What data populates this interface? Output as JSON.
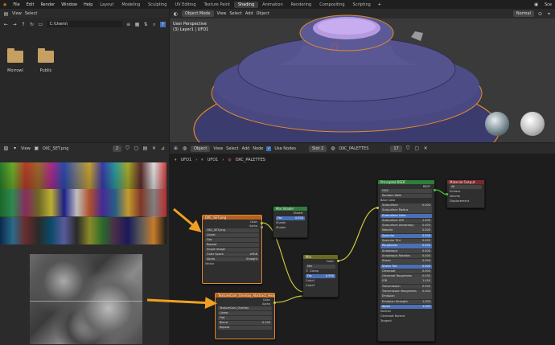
{
  "menu": {
    "items": [
      "File",
      "Edit",
      "Render",
      "Window",
      "Help"
    ],
    "workspaces": [
      "Layout",
      "Modeling",
      "Sculpting",
      "UV Editing",
      "Texture Paint",
      "Shading",
      "Animation",
      "Rendering",
      "Compositing",
      "Scripting"
    ],
    "active_workspace": "Shading",
    "scene_label": "Sce"
  },
  "file_browser": {
    "view": "View",
    "select": "Select",
    "path": "C:\\Users\\",
    "folders": [
      "Morrowl",
      "Public"
    ]
  },
  "viewport": {
    "mode": "Object Mode",
    "menu": [
      "View",
      "Select",
      "Add",
      "Object"
    ],
    "shading": "Normal",
    "info_line1": "User Perspective",
    "info_line2": "(3) Layer1 | UFO1"
  },
  "image_editor": {
    "view": "View",
    "image_name": "OXC_SET.png",
    "users": "2"
  },
  "node_editor": {
    "mode": "Object",
    "menu": [
      "View",
      "Select",
      "Add",
      "Node"
    ],
    "use_nodes": "Use Nodes",
    "slot": "Slot 2",
    "material": "OXC_PALETTES",
    "material_users": "17",
    "breadcrumb": [
      "UFO1",
      "UFO1",
      "OXC_PALETTES"
    ]
  },
  "nodes": {
    "img1": {
      "title": "OXC_SET.png",
      "out_color": "Color",
      "out_alpha": "Alpha",
      "image": "OXC_SET.png",
      "rows": [
        "Linear",
        "Flat",
        "Repeat",
        "Single Image"
      ],
      "cs_label": "Color Space",
      "cs_value": "sRGB",
      "alpha_label": "Alpha",
      "alpha_value": "Straight",
      "vector": "Vector"
    },
    "mix_shader": {
      "title": "Mix Shader",
      "out": "Shader",
      "fac": "Fac",
      "fac_value": "0.500",
      "in1": "Shader",
      "in2": "Shader"
    },
    "mix": {
      "title": "Mix",
      "out": "Color",
      "blend": "Mix",
      "clamp": "Clamp",
      "fac": "Fac",
      "fac_value": "0.500",
      "in1": "Color1",
      "in2": "Color2"
    },
    "img2": {
      "title": "TextureCom_Overlay_Abstract_Header.png",
      "out_color": "Color",
      "out_alpha": "Alpha",
      "image": "TextureCom_Overlay",
      "rows": [
        "Linear",
        "Flat"
      ],
      "blend": "Blend",
      "blend_value": "0.100",
      "repeat": "Repeat"
    },
    "bsdf": {
      "title": "Principled BSDF",
      "out": "BSDF",
      "gx": "GGX",
      "rw": "Random Walk",
      "base_color": "Base Color",
      "params": [
        {
          "l": "Subsurface",
          "v": "0.000"
        },
        {
          "l": "Subsurface Radius",
          "v": ""
        },
        {
          "l": "Subsurface Color",
          "v": ""
        },
        {
          "l": "Subsurface IOR",
          "v": "1.400"
        },
        {
          "l": "Subsurface Anisotropy",
          "v": "0.000"
        },
        {
          "l": "Metallic",
          "v": "0.000"
        },
        {
          "l": "Specular",
          "v": "0.500"
        },
        {
          "l": "Specular Tint",
          "v": "0.000"
        },
        {
          "l": "Roughness",
          "v": "0.500"
        },
        {
          "l": "Anisotropic",
          "v": "0.000"
        },
        {
          "l": "Anisotropic Rotation",
          "v": "0.000"
        },
        {
          "l": "Sheen",
          "v": "0.000"
        },
        {
          "l": "Sheen Tint",
          "v": "0.500"
        },
        {
          "l": "Clearcoat",
          "v": "0.000"
        },
        {
          "l": "Clearcoat Roughness",
          "v": "0.030"
        },
        {
          "l": "IOR",
          "v": "1.450"
        },
        {
          "l": "Transmission",
          "v": "0.000"
        },
        {
          "l": "Transmission Roughness",
          "v": "0.000"
        },
        {
          "l": "Emission",
          "v": ""
        },
        {
          "l": "Emission Strength",
          "v": "1.000"
        },
        {
          "l": "Alpha",
          "v": "1.000"
        }
      ],
      "tail": [
        "Normal",
        "Clearcoat Normal",
        "Tangent"
      ]
    },
    "output": {
      "title": "Material Output",
      "target": "All",
      "in": [
        "Surface",
        "Volume",
        "Displacement"
      ]
    }
  },
  "colors": {
    "accent_orange": "#f0a020",
    "selection": "#e08a2c",
    "shader_green": "#2e7d3a",
    "texture_orange": "#b5611f",
    "color_yellow": "#6b6b1f",
    "output_red": "#7a2a2a"
  }
}
